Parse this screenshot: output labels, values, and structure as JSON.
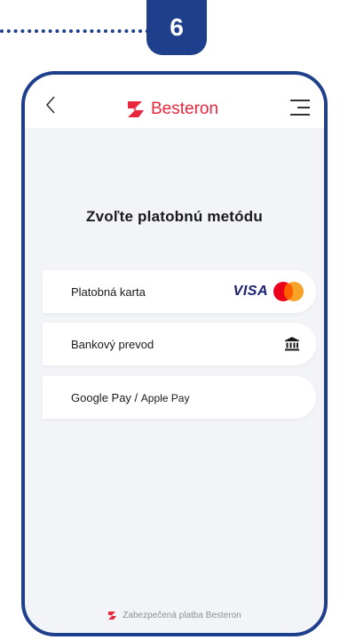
{
  "step": {
    "number": "6"
  },
  "header": {
    "brand": "Besteron"
  },
  "main": {
    "title": "Zvoľte platobnú metódu",
    "methods": [
      {
        "label": "Platobná karta",
        "logos": "VISA"
      },
      {
        "label": "Bankový prevod",
        "icon": "bank-icon"
      },
      {
        "label": "Google Pay",
        "separator": " / ",
        "sublabel": "Apple Pay"
      }
    ]
  },
  "footer": {
    "text": "Zabezpečená platba Besteron"
  },
  "colors": {
    "brand": "#e8263c",
    "frame": "#1d3f8c",
    "visa": "#1a1f71"
  }
}
